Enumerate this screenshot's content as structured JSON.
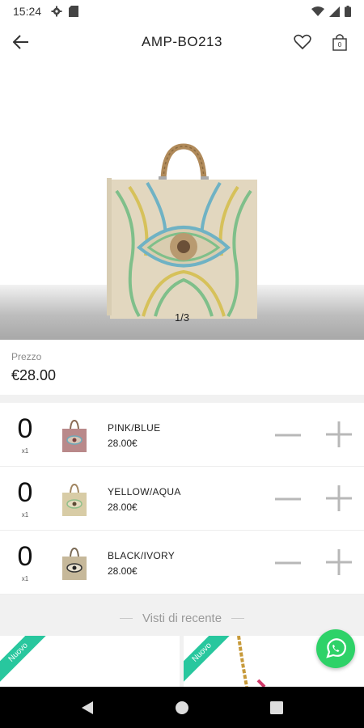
{
  "status_bar": {
    "time": "15:24",
    "icons": [
      "gear-icon",
      "sd-card-icon",
      "wifi-icon",
      "signal-icon",
      "battery-icon"
    ]
  },
  "app_bar": {
    "title": "AMP-BO213",
    "icons": [
      "back-arrow-icon",
      "heart-icon",
      "shopping-bag-icon"
    ],
    "cart_count": "0"
  },
  "gallery": {
    "pager": "1/3"
  },
  "price": {
    "label": "Prezzo",
    "value": "€28.00"
  },
  "variants": [
    {
      "qty": "0",
      "multiplier": "x1",
      "name": "PINK/BLUE",
      "price": "28.00€"
    },
    {
      "qty": "0",
      "multiplier": "x1",
      "name": "YELLOW/AQUA",
      "price": "28.00€"
    },
    {
      "qty": "0",
      "multiplier": "x1",
      "name": "BLACK/IVORY",
      "price": "28.00€"
    }
  ],
  "recent": {
    "title": "Visti di recente",
    "items": [
      {
        "badge": "Nuovo"
      },
      {
        "badge": "Nuovo"
      }
    ]
  },
  "colors": {
    "accent_green": "#28c79e",
    "whatsapp_green": "#2ed268",
    "stepper_gray": "#b8b8b8"
  }
}
